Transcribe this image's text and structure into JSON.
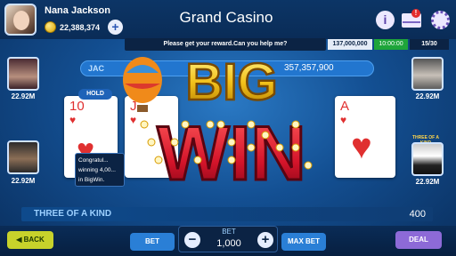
{
  "player": {
    "name": "Nana Jackson",
    "coins": "22,388,374"
  },
  "header": {
    "title": "Grand Casino",
    "info_label": "i",
    "mail_badge": "!",
    "add_label": "+"
  },
  "message": "Please get your reward.Can you help me?",
  "status": {
    "jackpot": "137,000,000",
    "timer": "10:00:00",
    "round": "15/30"
  },
  "jackpot_bar": {
    "label": "JAC",
    "value": "357,357,900"
  },
  "seats": [
    {
      "amount": "22.92M"
    },
    {
      "amount": "22.92M"
    },
    {
      "amount": "22.92M"
    },
    {
      "amount": "22.92M",
      "label": "THREE OF A KIND"
    }
  ],
  "hold_label": "HOLD",
  "cards": [
    {
      "rank": "10",
      "suit": "♥"
    },
    {
      "rank": "J",
      "suit": "♥"
    },
    {
      "rank": "A",
      "suit": "♥"
    }
  ],
  "tooltip": {
    "text": "Congratul... winning 4,00... in BigWin."
  },
  "banner": {
    "line1": "BIG",
    "line2": "WIN"
  },
  "hand": {
    "name": "THREE OF A KIND",
    "payout": "400"
  },
  "controls": {
    "back": "BACK",
    "bet": "BET",
    "bet_label": "BET",
    "bet_value": "1,000",
    "max_bet": "MAX BET",
    "deal": "DEAL",
    "minus": "−",
    "plus": "+"
  },
  "colors": {
    "accent": "#2a7fd6",
    "back": "#c7d22b",
    "deal": "#8d6ad7",
    "banner_red": "#d4142a",
    "banner_gold": "#f3c21b"
  }
}
